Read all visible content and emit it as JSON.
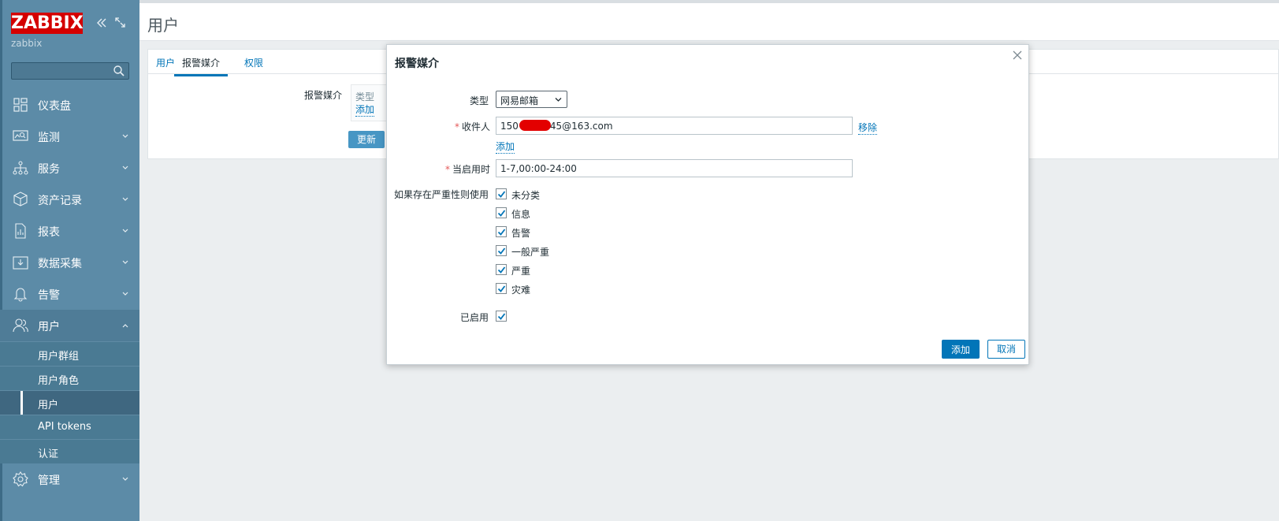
{
  "sidebar": {
    "logo": "ZABBIX",
    "server_name": "zabbix",
    "search_value": "",
    "menu": [
      {
        "label": "仪表盘",
        "icon": "dashboard-icon"
      },
      {
        "label": "监测",
        "icon": "monitoring-icon"
      },
      {
        "label": "服务",
        "icon": "services-icon"
      },
      {
        "label": "资产记录",
        "icon": "inventory-icon"
      },
      {
        "label": "报表",
        "icon": "reports-icon"
      },
      {
        "label": "数据采集",
        "icon": "data-collection-icon"
      },
      {
        "label": "告警",
        "icon": "alerts-icon"
      },
      {
        "label": "用户",
        "icon": "users-icon"
      },
      {
        "label": "管理",
        "icon": "administration-icon"
      }
    ],
    "users_submenu": [
      {
        "label": "用户群组"
      },
      {
        "label": "用户角色"
      },
      {
        "label": "用户",
        "selected": true
      },
      {
        "label": "API tokens"
      },
      {
        "label": "认证"
      }
    ]
  },
  "header": {
    "title": "用户"
  },
  "tabs": [
    "用户",
    "报警媒介",
    "权限"
  ],
  "media_form": {
    "field_label": "报警媒介",
    "type_head": "类型",
    "add_link": "添加",
    "update_button": "更新"
  },
  "dialog": {
    "title": "报警媒介",
    "type_label": "类型",
    "type_value": "网易邮箱",
    "send_to_label": "收件人",
    "send_to_prefix": "150",
    "send_to_suffix": "45@163.com",
    "remove_link": "移除",
    "add_link": "添加",
    "when_active_label": "当启用时",
    "when_active_value": "1-7,00:00-24:00",
    "severity_label": "如果存在严重性则使用",
    "severities": [
      "未分类",
      "信息",
      "告警",
      "一般严重",
      "严重",
      "灾难"
    ],
    "enabled_label": "已启用",
    "add_button": "添加",
    "cancel_button": "取消"
  },
  "colors": {
    "sidebar": "#5c8ba7",
    "logo_bg": "#d40000",
    "accent": "#0275b8"
  }
}
